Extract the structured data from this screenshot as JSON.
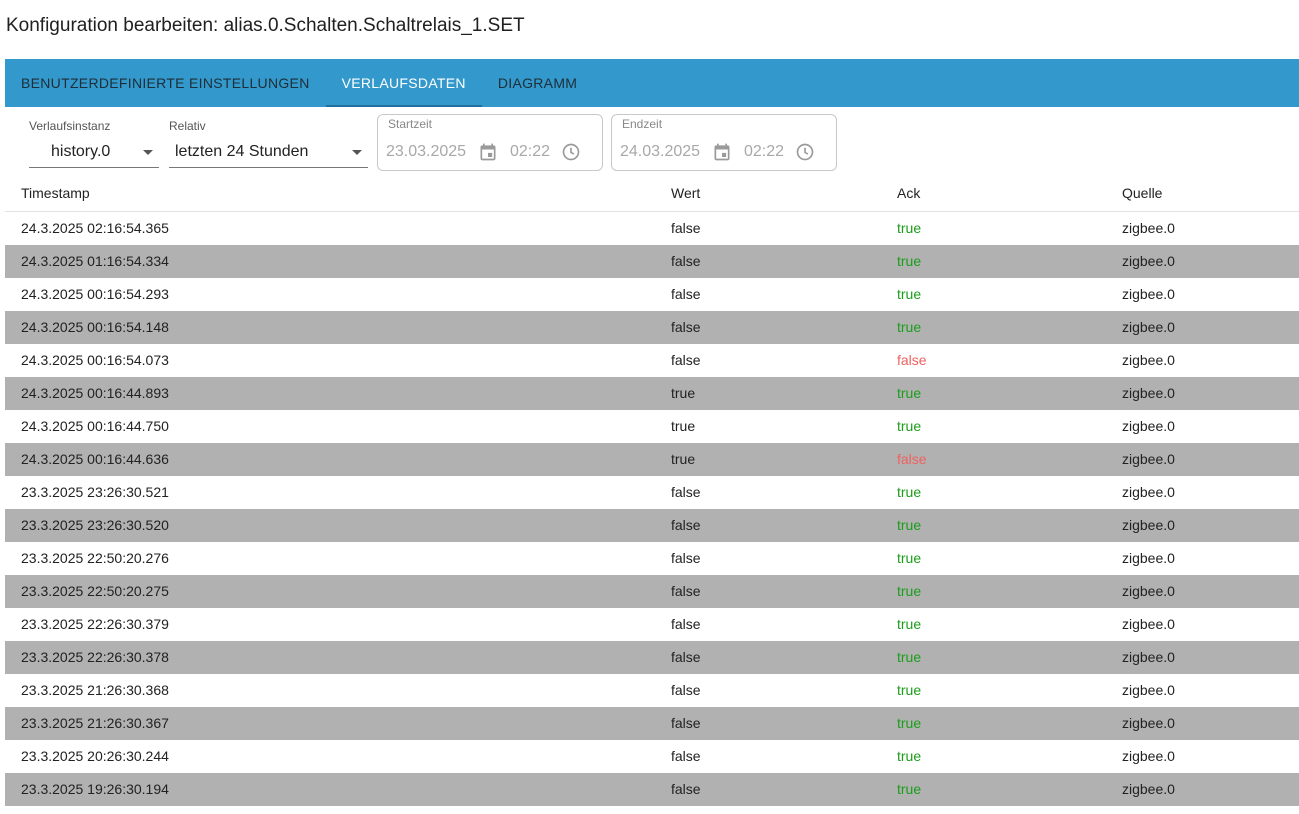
{
  "page": {
    "title": "Konfiguration bearbeiten: alias.0.Schalten.Schaltrelais_1.SET"
  },
  "tabs": [
    {
      "label": "BENUTZERDEFINIERTE EINSTELLUNGEN",
      "active": false
    },
    {
      "label": "VERLAUFSDATEN",
      "active": true
    },
    {
      "label": "DIAGRAMM",
      "active": false
    }
  ],
  "filters": {
    "instance": {
      "label": "Verlaufsinstanz",
      "value": "history.0"
    },
    "relative": {
      "label": "Relativ",
      "value": "letzten 24 Stunden"
    },
    "start": {
      "label": "Startzeit",
      "date": "23.03.2025",
      "time": "02:22"
    },
    "end": {
      "label": "Endzeit",
      "date": "24.03.2025",
      "time": "02:22"
    }
  },
  "table": {
    "columns": [
      "Timestamp",
      "Wert",
      "Ack",
      "Quelle"
    ],
    "rows": [
      {
        "ts": "24.3.2025 02:16:54.365",
        "val": "false",
        "ack": "true",
        "src": "zigbee.0"
      },
      {
        "ts": "24.3.2025 01:16:54.334",
        "val": "false",
        "ack": "true",
        "src": "zigbee.0"
      },
      {
        "ts": "24.3.2025 00:16:54.293",
        "val": "false",
        "ack": "true",
        "src": "zigbee.0"
      },
      {
        "ts": "24.3.2025 00:16:54.148",
        "val": "false",
        "ack": "true",
        "src": "zigbee.0"
      },
      {
        "ts": "24.3.2025 00:16:54.073",
        "val": "false",
        "ack": "false",
        "src": "zigbee.0"
      },
      {
        "ts": "24.3.2025 00:16:44.893",
        "val": "true",
        "ack": "true",
        "src": "zigbee.0"
      },
      {
        "ts": "24.3.2025 00:16:44.750",
        "val": "true",
        "ack": "true",
        "src": "zigbee.0"
      },
      {
        "ts": "24.3.2025 00:16:44.636",
        "val": "true",
        "ack": "false",
        "src": "zigbee.0"
      },
      {
        "ts": "23.3.2025 23:26:30.521",
        "val": "false",
        "ack": "true",
        "src": "zigbee.0"
      },
      {
        "ts": "23.3.2025 23:26:30.520",
        "val": "false",
        "ack": "true",
        "src": "zigbee.0"
      },
      {
        "ts": "23.3.2025 22:50:20.276",
        "val": "false",
        "ack": "true",
        "src": "zigbee.0"
      },
      {
        "ts": "23.3.2025 22:50:20.275",
        "val": "false",
        "ack": "true",
        "src": "zigbee.0"
      },
      {
        "ts": "23.3.2025 22:26:30.379",
        "val": "false",
        "ack": "true",
        "src": "zigbee.0"
      },
      {
        "ts": "23.3.2025 22:26:30.378",
        "val": "false",
        "ack": "true",
        "src": "zigbee.0"
      },
      {
        "ts": "23.3.2025 21:26:30.368",
        "val": "false",
        "ack": "true",
        "src": "zigbee.0"
      },
      {
        "ts": "23.3.2025 21:26:30.367",
        "val": "false",
        "ack": "true",
        "src": "zigbee.0"
      },
      {
        "ts": "23.3.2025 20:26:30.244",
        "val": "false",
        "ack": "true",
        "src": "zigbee.0"
      },
      {
        "ts": "23.3.2025 19:26:30.194",
        "val": "false",
        "ack": "true",
        "src": "zigbee.0"
      }
    ]
  },
  "colors": {
    "tabbar": "#3399cc",
    "stripe": "#b1b1b1",
    "ack_true": "#1a9e1a",
    "ack_false": "#f06060"
  },
  "icons": {
    "date": "calendar-icon",
    "time": "clock-icon",
    "dropdown": "caret-down-icon"
  }
}
